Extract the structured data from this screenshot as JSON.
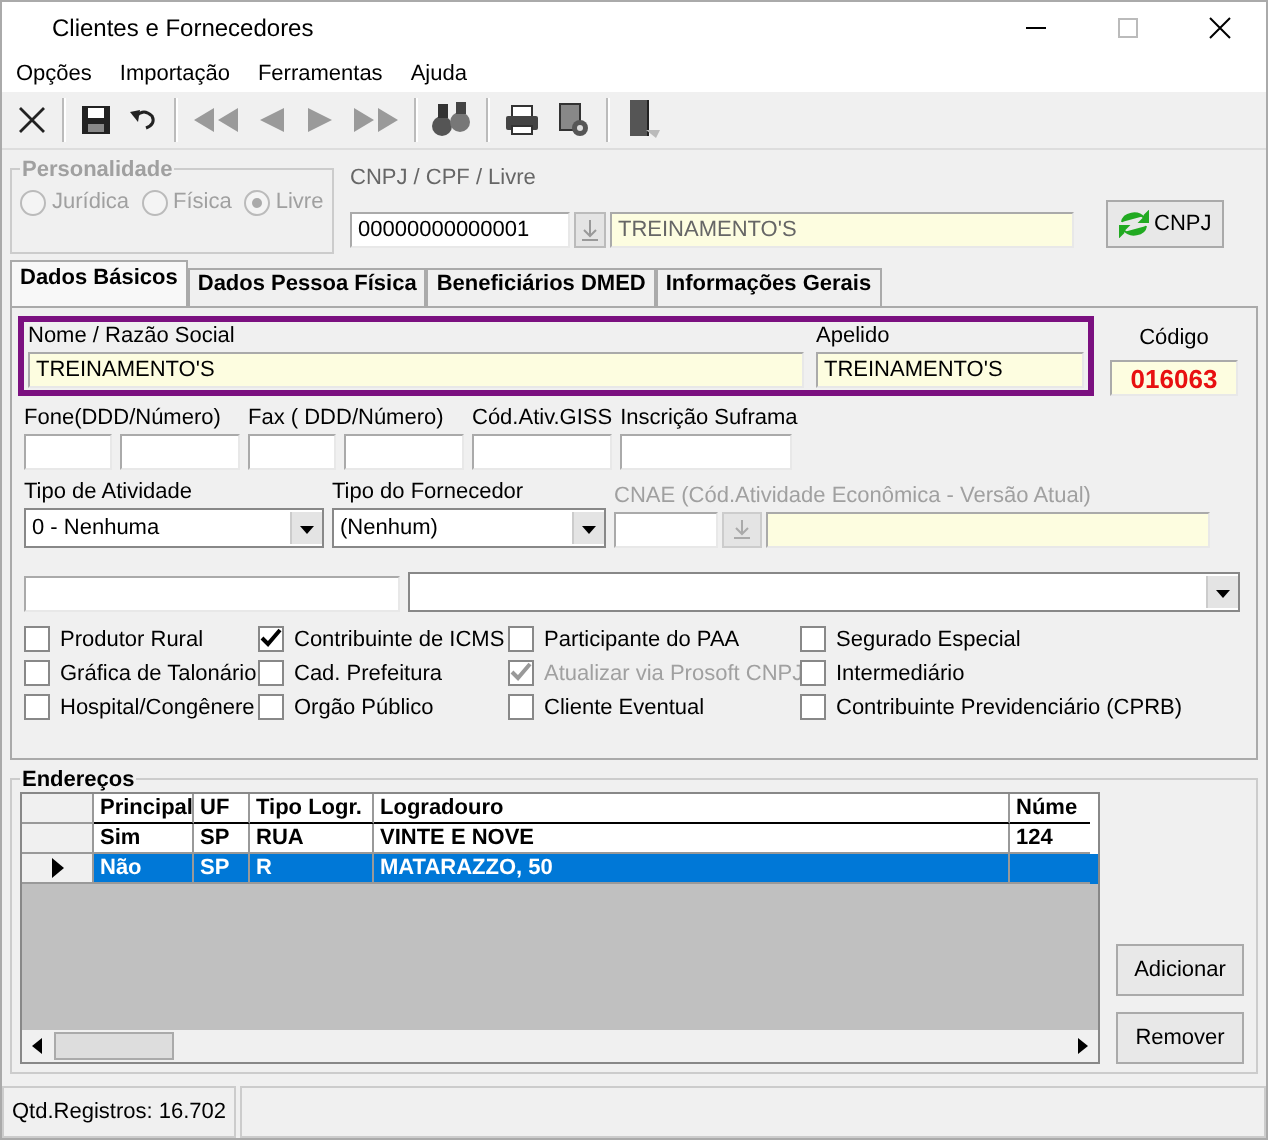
{
  "window": {
    "title": "Clientes e Fornecedores"
  },
  "menu": [
    "Opções",
    "Importação",
    "Ferramentas",
    "Ajuda"
  ],
  "personalidade": {
    "title": "Personalidade",
    "disabled": true,
    "options": [
      {
        "label": "Jurídica",
        "selected": false
      },
      {
        "label": "Física",
        "selected": false
      },
      {
        "label": "Livre",
        "selected": true
      }
    ]
  },
  "cnpj": {
    "label": "CNPJ / CPF / Livre",
    "value": "00000000000001",
    "name": "TREINAMENTO'S",
    "button": "CNPJ"
  },
  "tabs": [
    {
      "label": "Dados Básicos",
      "selected": true
    },
    {
      "label": "Dados Pessoa Física",
      "selected": false
    },
    {
      "label": "Beneficiários DMED",
      "selected": false
    },
    {
      "label": "Informações Gerais",
      "selected": false
    }
  ],
  "nome": {
    "label": "Nome / Razão Social",
    "value": "TREINAMENTO'S"
  },
  "apelido": {
    "label": "Apelido",
    "value": "TREINAMENTO'S"
  },
  "codigo": {
    "label": "Código",
    "value": "016063"
  },
  "contact_fields": [
    {
      "label": "Fone(DDD/Número)",
      "kind": "pair"
    },
    {
      "label": "Fax ( DDD/Número)",
      "kind": "pair"
    },
    {
      "label": "Cód.Ativ.GISS",
      "kind": "single"
    },
    {
      "label": "Inscrição Suframa",
      "kind": "single"
    }
  ],
  "tipo_atividade": {
    "label": "Tipo de Atividade",
    "value": "0 - Nenhuma"
  },
  "tipo_fornecedor": {
    "label": "Tipo do Fornecedor",
    "value": "(Nenhum)"
  },
  "cnae": {
    "label": "CNAE (Cód.Atividade Econômica - Versão Atual)",
    "disabled": true
  },
  "checkbox_columns": [
    [
      {
        "label": "Produtor Rural",
        "checked": false,
        "disabled": false
      },
      {
        "label": "Gráfica de Talonário",
        "checked": false,
        "disabled": false
      },
      {
        "label": "Hospital/Congênere",
        "checked": false,
        "disabled": false
      }
    ],
    [
      {
        "label": "Contribuinte de ICMS",
        "checked": true,
        "disabled": false
      },
      {
        "label": "Cad. Prefeitura",
        "checked": false,
        "disabled": false
      },
      {
        "label": "Orgão Público",
        "checked": false,
        "disabled": false
      }
    ],
    [
      {
        "label": "Participante do PAA",
        "checked": false,
        "disabled": false
      },
      {
        "label": "Atualizar via Prosoft CNPJ",
        "checked": true,
        "disabled": true
      },
      {
        "label": "Cliente Eventual",
        "checked": false,
        "disabled": false
      }
    ],
    [
      {
        "label": "Segurado Especial",
        "checked": false,
        "disabled": false
      },
      {
        "label": "Intermediário",
        "checked": false,
        "disabled": false
      },
      {
        "label": "Contribuinte Previdenciário (CPRB)",
        "checked": false,
        "disabled": false
      }
    ]
  ],
  "enderecos": {
    "title": "Endereços",
    "columns": [
      "Principal",
      "UF",
      "Tipo Logr.",
      "Logradouro",
      "Núme"
    ],
    "rows": [
      {
        "cells": [
          "Sim",
          "SP",
          "RUA",
          "VINTE E NOVE",
          "124"
        ],
        "selected": false
      },
      {
        "cells": [
          "Não",
          "SP",
          "R",
          "MATARAZZO, 50",
          ""
        ],
        "selected": true
      }
    ],
    "buttons": [
      "Adicionar",
      "Remover"
    ]
  },
  "status_bar": [
    "Qtd.Registros: 16.702"
  ]
}
